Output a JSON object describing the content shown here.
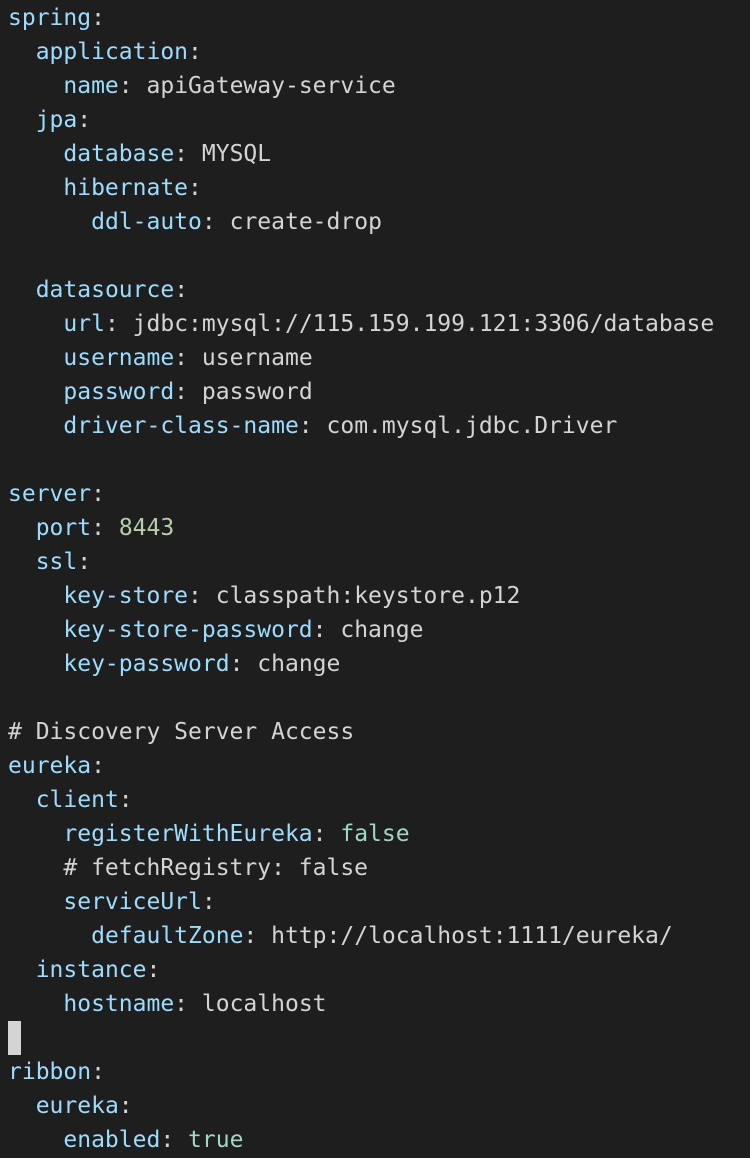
{
  "colors": {
    "background": "#1e1e1e",
    "key": "#9cdcfe",
    "text": "#d4d4d4",
    "number": "#b5cea8",
    "boolean": "#9fd8c8"
  },
  "lines": [
    {
      "indent": "",
      "key": "spring",
      "kind": "key"
    },
    {
      "indent": "  ",
      "key": "application",
      "kind": "key"
    },
    {
      "indent": "    ",
      "key": "name",
      "value": "apiGateway-service",
      "kind": "str"
    },
    {
      "indent": "  ",
      "key": "jpa",
      "kind": "key"
    },
    {
      "indent": "    ",
      "key": "database",
      "value": "MYSQL",
      "kind": "str"
    },
    {
      "indent": "    ",
      "key": "hibernate",
      "kind": "key"
    },
    {
      "indent": "      ",
      "key": "ddl-auto",
      "value": "create-drop",
      "kind": "str"
    },
    {
      "kind": "blank"
    },
    {
      "indent": "  ",
      "key": "datasource",
      "kind": "key"
    },
    {
      "indent": "    ",
      "key": "url",
      "value": "jdbc:mysql://115.159.199.121:3306/database",
      "kind": "str"
    },
    {
      "indent": "    ",
      "key": "username",
      "value": "username",
      "kind": "str"
    },
    {
      "indent": "    ",
      "key": "password",
      "value": "password",
      "kind": "str"
    },
    {
      "indent": "    ",
      "key": "driver-class-name",
      "value": "com.mysql.jdbc.Driver",
      "kind": "str"
    },
    {
      "kind": "blank"
    },
    {
      "indent": "",
      "key": "server",
      "kind": "key"
    },
    {
      "indent": "  ",
      "key": "port",
      "value": "8443",
      "kind": "num"
    },
    {
      "indent": "  ",
      "key": "ssl",
      "kind": "key"
    },
    {
      "indent": "    ",
      "key": "key-store",
      "value": "classpath:keystore.p12",
      "kind": "str"
    },
    {
      "indent": "    ",
      "key": "key-store-password",
      "value": "change",
      "kind": "str"
    },
    {
      "indent": "    ",
      "key": "key-password",
      "value": "change",
      "kind": "str"
    },
    {
      "kind": "blank"
    },
    {
      "indent": "",
      "text": "# Discovery Server Access",
      "kind": "comment"
    },
    {
      "indent": "",
      "key": "eureka",
      "kind": "key"
    },
    {
      "indent": "  ",
      "key": "client",
      "kind": "key"
    },
    {
      "indent": "    ",
      "key": "registerWithEureka",
      "value": "false",
      "kind": "bool"
    },
    {
      "indent": "    ",
      "text": "# fetchRegistry: false",
      "kind": "comment"
    },
    {
      "indent": "    ",
      "key": "serviceUrl",
      "kind": "key"
    },
    {
      "indent": "      ",
      "key": "defaultZone",
      "value": "http://localhost:1111/eureka/",
      "kind": "str"
    },
    {
      "indent": "  ",
      "key": "instance",
      "kind": "key"
    },
    {
      "indent": "    ",
      "key": "hostname",
      "value": "localhost",
      "kind": "str"
    },
    {
      "kind": "cursor"
    },
    {
      "indent": "",
      "key": "ribbon",
      "kind": "key"
    },
    {
      "indent": "  ",
      "key": "eureka",
      "kind": "key"
    },
    {
      "indent": "    ",
      "key": "enabled",
      "value": "true",
      "kind": "bool"
    }
  ]
}
